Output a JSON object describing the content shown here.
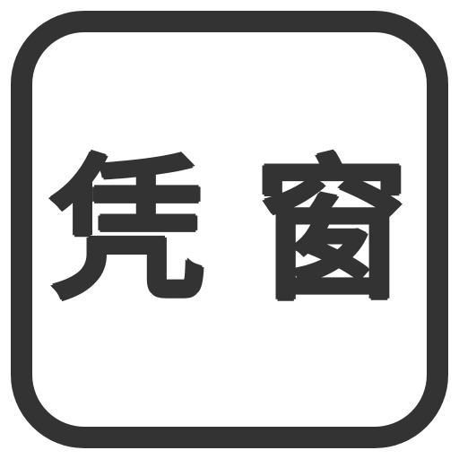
{
  "icon": {
    "character_1": "凭",
    "character_2": "窗",
    "stroke_color": "#333333",
    "background_color": "#ffffff"
  }
}
